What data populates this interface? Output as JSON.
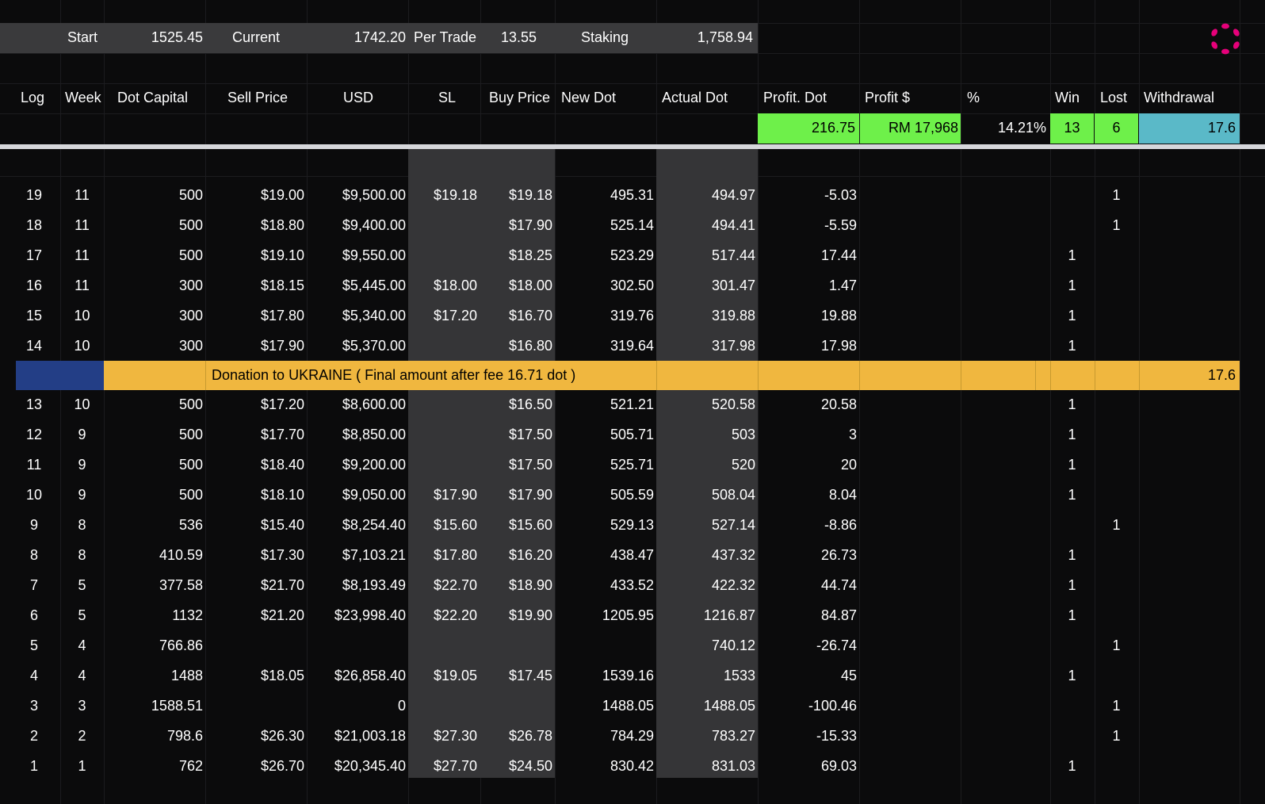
{
  "summary": {
    "start_label": "Start",
    "start_value": "1525.45",
    "current_label": "Current",
    "current_value": "1742.20",
    "per_trade_label": "Per Trade",
    "per_trade_value": "13.55",
    "staking_label": "Staking",
    "staking_value": "1,758.94"
  },
  "logo": {
    "icon": "polkadot-logo-icon",
    "color": "#e6007a"
  },
  "columns": [
    "Log",
    "Week",
    "Dot Capital",
    "Sell Price",
    "USD",
    "SL",
    "Buy Price",
    "New Dot",
    "Actual Dot",
    "Profit. Dot",
    "Profit $",
    "%",
    "Win",
    "Lost",
    "Withdrawal"
  ],
  "totals": {
    "profit_dot": "216.75",
    "profit_usd": "RM 17,968",
    "percent": "14.21%",
    "win": "13",
    "lost": "6",
    "withdrawal": "17.6"
  },
  "colors": {
    "green": "#6ef04a",
    "teal": "#5ab9c8",
    "orange": "#f0b73f",
    "navy": "#233e86",
    "header_bar": "#3a3a3c"
  },
  "rows_top": [
    {
      "log": "19",
      "week": "11",
      "capital": "500",
      "sell": "$19.00",
      "usd": "$9,500.00",
      "sl": "$19.18",
      "buy": "$19.18",
      "new_dot": "495.31",
      "actual": "494.97",
      "profit": "-5.03",
      "win": "",
      "lost": "1"
    },
    {
      "log": "18",
      "week": "11",
      "capital": "500",
      "sell": "$18.80",
      "usd": "$9,400.00",
      "sl": "",
      "buy": "$17.90",
      "new_dot": "525.14",
      "actual": "494.41",
      "profit": "-5.59",
      "win": "",
      "lost": "1"
    },
    {
      "log": "17",
      "week": "11",
      "capital": "500",
      "sell": "$19.10",
      "usd": "$9,550.00",
      "sl": "",
      "buy": "$18.25",
      "new_dot": "523.29",
      "actual": "517.44",
      "profit": "17.44",
      "win": "1",
      "lost": ""
    },
    {
      "log": "16",
      "week": "11",
      "capital": "300",
      "sell": "$18.15",
      "usd": "$5,445.00",
      "sl": "$18.00",
      "buy": "$18.00",
      "new_dot": "302.50",
      "actual": "301.47",
      "profit": "1.47",
      "win": "1",
      "lost": ""
    },
    {
      "log": "15",
      "week": "10",
      "capital": "300",
      "sell": "$17.80",
      "usd": "$5,340.00",
      "sl": "$17.20",
      "buy": "$16.70",
      "new_dot": "319.76",
      "actual": "319.88",
      "profit": "19.88",
      "win": "1",
      "lost": ""
    },
    {
      "log": "14",
      "week": "10",
      "capital": "300",
      "sell": "$17.90",
      "usd": "$5,370.00",
      "sl": "",
      "buy": "$16.80",
      "new_dot": "319.64",
      "actual": "317.98",
      "profit": "17.98",
      "win": "1",
      "lost": ""
    }
  ],
  "donation": {
    "text": "Donation to UKRAINE ( Final amount after fee 16.71 dot )",
    "withdrawal": "17.6"
  },
  "rows_bottom": [
    {
      "log": "13",
      "week": "10",
      "capital": "500",
      "sell": "$17.20",
      "usd": "$8,600.00",
      "sl": "",
      "buy": "$16.50",
      "new_dot": "521.21",
      "actual": "520.58",
      "profit": "20.58",
      "win": "1",
      "lost": ""
    },
    {
      "log": "12",
      "week": "9",
      "capital": "500",
      "sell": "$17.70",
      "usd": "$8,850.00",
      "sl": "",
      "buy": "$17.50",
      "new_dot": "505.71",
      "actual": "503",
      "profit": "3",
      "win": "1",
      "lost": ""
    },
    {
      "log": "11",
      "week": "9",
      "capital": "500",
      "sell": "$18.40",
      "usd": "$9,200.00",
      "sl": "",
      "buy": "$17.50",
      "new_dot": "525.71",
      "actual": "520",
      "profit": "20",
      "win": "1",
      "lost": ""
    },
    {
      "log": "10",
      "week": "9",
      "capital": "500",
      "sell": "$18.10",
      "usd": "$9,050.00",
      "sl": "$17.90",
      "buy": "$17.90",
      "new_dot": "505.59",
      "actual": "508.04",
      "profit": "8.04",
      "win": "1",
      "lost": ""
    },
    {
      "log": "9",
      "week": "8",
      "capital": "536",
      "sell": "$15.40",
      "usd": "$8,254.40",
      "sl": "$15.60",
      "buy": "$15.60",
      "new_dot": "529.13",
      "actual": "527.14",
      "profit": "-8.86",
      "win": "",
      "lost": "1"
    },
    {
      "log": "8",
      "week": "8",
      "capital": "410.59",
      "sell": "$17.30",
      "usd": "$7,103.21",
      "sl": "$17.80",
      "buy": "$16.20",
      "new_dot": "438.47",
      "actual": "437.32",
      "profit": "26.73",
      "win": "1",
      "lost": ""
    },
    {
      "log": "7",
      "week": "5",
      "capital": "377.58",
      "sell": "$21.70",
      "usd": "$8,193.49",
      "sl": "$22.70",
      "buy": "$18.90",
      "new_dot": "433.52",
      "actual": "422.32",
      "profit": "44.74",
      "win": "1",
      "lost": ""
    },
    {
      "log": "6",
      "week": "5",
      "capital": "1132",
      "sell": "$21.20",
      "usd": "$23,998.40",
      "sl": "$22.20",
      "buy": "$19.90",
      "new_dot": "1205.95",
      "actual": "1216.87",
      "profit": "84.87",
      "win": "1",
      "lost": ""
    },
    {
      "log": "5",
      "week": "4",
      "capital": "766.86",
      "sell": "",
      "usd": "",
      "sl": "",
      "buy": "",
      "new_dot": "",
      "actual": "740.12",
      "profit": "-26.74",
      "win": "",
      "lost": "1"
    },
    {
      "log": "4",
      "week": "4",
      "capital": "1488",
      "sell": "$18.05",
      "usd": "$26,858.40",
      "sl": "$19.05",
      "buy": "$17.45",
      "new_dot": "1539.16",
      "actual": "1533",
      "profit": "45",
      "win": "1",
      "lost": ""
    },
    {
      "log": "3",
      "week": "3",
      "capital": "1588.51",
      "sell": "",
      "usd": "0",
      "sl": "",
      "buy": "",
      "new_dot": "1488.05",
      "actual": "1488.05",
      "profit": "-100.46",
      "win": "",
      "lost": "1"
    },
    {
      "log": "2",
      "week": "2",
      "capital": "798.6",
      "sell": "$26.30",
      "usd": "$21,003.18",
      "sl": "$27.30",
      "buy": "$26.78",
      "new_dot": "784.29",
      "actual": "783.27",
      "profit": "-15.33",
      "win": "",
      "lost": "1"
    },
    {
      "log": "1",
      "week": "1",
      "capital": "762",
      "sell": "$26.70",
      "usd": "$20,345.40",
      "sl": "$27.70",
      "buy": "$24.50",
      "new_dot": "830.42",
      "actual": "831.03",
      "profit": "69.03",
      "win": "1",
      "lost": ""
    }
  ]
}
